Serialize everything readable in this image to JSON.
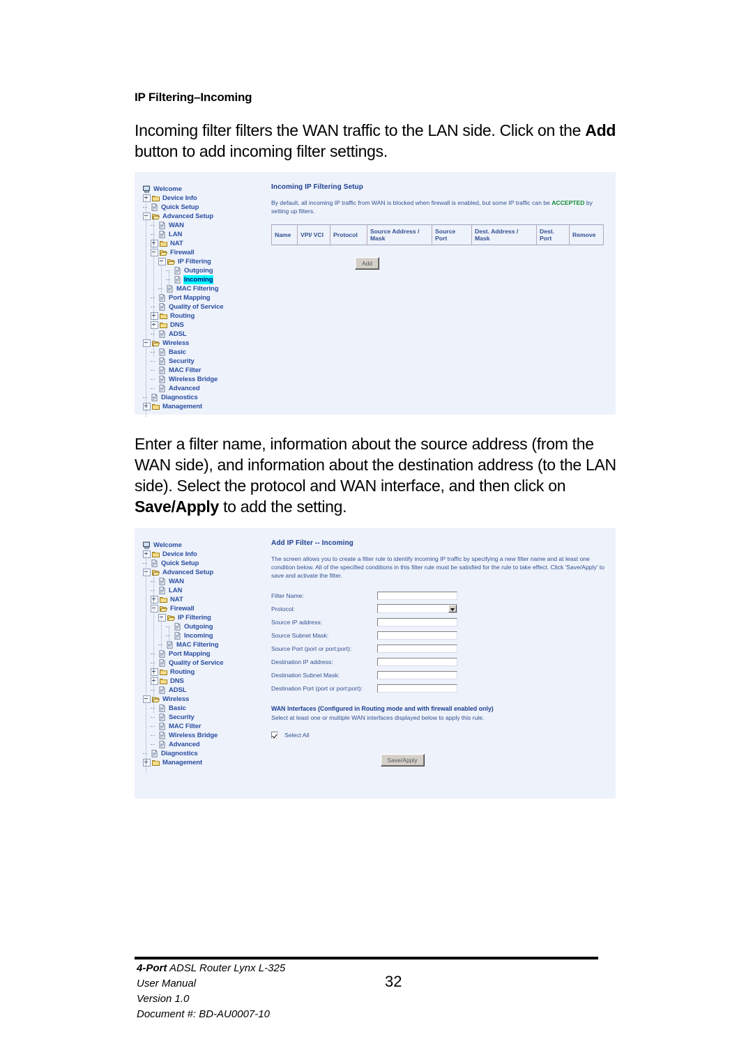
{
  "document": {
    "heading": "IP Filtering–Incoming",
    "paragraph1_pre": "Incoming filter filters the WAN traffic to the LAN side.  Click on the ",
    "paragraph1_bold": "Add",
    "paragraph1_post": " button to add incoming filter settings.",
    "paragraph2_pre": "Enter a filter name, information about the source address (from the WAN side), and information about the destination address (to the LAN side). Select the protocol and WAN interface, and then click on ",
    "paragraph2_bold": "Save/Apply",
    "paragraph2_post": " to add the setting."
  },
  "nav_tree": {
    "items": [
      {
        "label": "Welcome",
        "depth": 0,
        "icon": "computer-icon",
        "expander": "none"
      },
      {
        "label": "Device Info",
        "depth": 0,
        "icon": "folder-closed-icon",
        "expander": "plus"
      },
      {
        "label": "Quick Setup",
        "depth": 0,
        "icon": "page-icon",
        "expander": "none"
      },
      {
        "label": "Advanced Setup",
        "depth": 0,
        "icon": "folder-open-icon",
        "expander": "minus"
      },
      {
        "label": "WAN",
        "depth": 1,
        "icon": "page-icon",
        "expander": "none"
      },
      {
        "label": "LAN",
        "depth": 1,
        "icon": "page-icon",
        "expander": "none"
      },
      {
        "label": "NAT",
        "depth": 1,
        "icon": "folder-closed-icon",
        "expander": "plus"
      },
      {
        "label": "Firewall",
        "depth": 1,
        "icon": "folder-open-icon",
        "expander": "minus"
      },
      {
        "label": "IP Filtering",
        "depth": 2,
        "icon": "folder-open-icon",
        "expander": "minus"
      },
      {
        "label": "Outgoing",
        "depth": 3,
        "icon": "page-icon",
        "expander": "none"
      },
      {
        "label": "Incoming",
        "depth": 3,
        "icon": "page-icon",
        "expander": "none"
      },
      {
        "label": "MAC Filtering",
        "depth": 2,
        "icon": "page-icon",
        "expander": "none"
      },
      {
        "label": "Port Mapping",
        "depth": 1,
        "icon": "page-icon",
        "expander": "none"
      },
      {
        "label": "Quality of Service",
        "depth": 1,
        "icon": "page-icon",
        "expander": "none"
      },
      {
        "label": "Routing",
        "depth": 1,
        "icon": "folder-closed-icon",
        "expander": "plus"
      },
      {
        "label": "DNS",
        "depth": 1,
        "icon": "folder-closed-icon",
        "expander": "plus"
      },
      {
        "label": "ADSL",
        "depth": 1,
        "icon": "page-icon",
        "expander": "none"
      },
      {
        "label": "Wireless",
        "depth": 0,
        "icon": "folder-open-icon",
        "expander": "minus"
      },
      {
        "label": "Basic",
        "depth": 1,
        "icon": "page-icon",
        "expander": "none"
      },
      {
        "label": "Security",
        "depth": 1,
        "icon": "page-icon",
        "expander": "none"
      },
      {
        "label": "MAC Filter",
        "depth": 1,
        "icon": "page-icon",
        "expander": "none"
      },
      {
        "label": "Wireless Bridge",
        "depth": 1,
        "icon": "page-icon",
        "expander": "none"
      },
      {
        "label": "Advanced",
        "depth": 1,
        "icon": "page-icon",
        "expander": "none"
      },
      {
        "label": "Diagnostics",
        "depth": 0,
        "icon": "page-icon",
        "expander": "none"
      },
      {
        "label": "Management",
        "depth": 0,
        "icon": "folder-closed-icon",
        "expander": "plus"
      }
    ],
    "selected_label": "Incoming",
    "selection_highlight_color": "#00ffff"
  },
  "screen_incoming_list": {
    "title": "Incoming IP Filtering Setup",
    "desc_pre": "By default, all incoming IP traffic from WAN is blocked when firewall is enabled, but some IP traffic can be ",
    "desc_accent": "ACCEPTED",
    "desc_post": " by setting up filters.",
    "accent_color": "#128c32",
    "table": {
      "columns": [
        "Name",
        "VPI/ VCI",
        "Protocol",
        "Source Address / Mask",
        "Source Port",
        "Dest. Address / Mask",
        "Dest. Port",
        "Remove"
      ],
      "rows": []
    },
    "add_button": "Add"
  },
  "screen_add_filter": {
    "title": "Add IP Filter -- Incoming",
    "desc": "The screen allows you to create a filter rule to identify incoming IP traffic by specifying a new filter name and at least one condition below. All of the specified conditions in this filter rule must be satisfied for the rule to take effect. Click 'Save/Apply' to save and activate the filter.",
    "fields": [
      {
        "label": "Filter Name:",
        "type": "text",
        "value": ""
      },
      {
        "label": "Protocol:",
        "type": "select",
        "value": ""
      },
      {
        "label": "Source IP address:",
        "type": "text",
        "value": ""
      },
      {
        "label": "Source Subnet Mask:",
        "type": "text",
        "value": ""
      },
      {
        "label": "Source Port (port or port:port):",
        "type": "text",
        "value": ""
      },
      {
        "label": "Destination IP address:",
        "type": "text",
        "value": ""
      },
      {
        "label": "Destination Subnet Mask:",
        "type": "text",
        "value": ""
      },
      {
        "label": "Destination Port (port or port:port):",
        "type": "text",
        "value": ""
      }
    ],
    "wan_heading": "WAN Interfaces (Configured in Routing mode and with firewall enabled only)",
    "wan_subtext": "Select at least one or multiple WAN interfaces displayed below to apply this rule.",
    "select_all_label": "Select All",
    "select_all_checked": true,
    "save_button": "Save/Apply"
  },
  "footer": {
    "line1_bold": "4-Port",
    "line1_rest": " ADSL Router Lynx L-325",
    "line2": "User Manual",
    "line3": "Version 1.0",
    "line4_bold": "Document #:",
    "line4_rest": " BD-AU0007-10",
    "page_number": "32"
  }
}
